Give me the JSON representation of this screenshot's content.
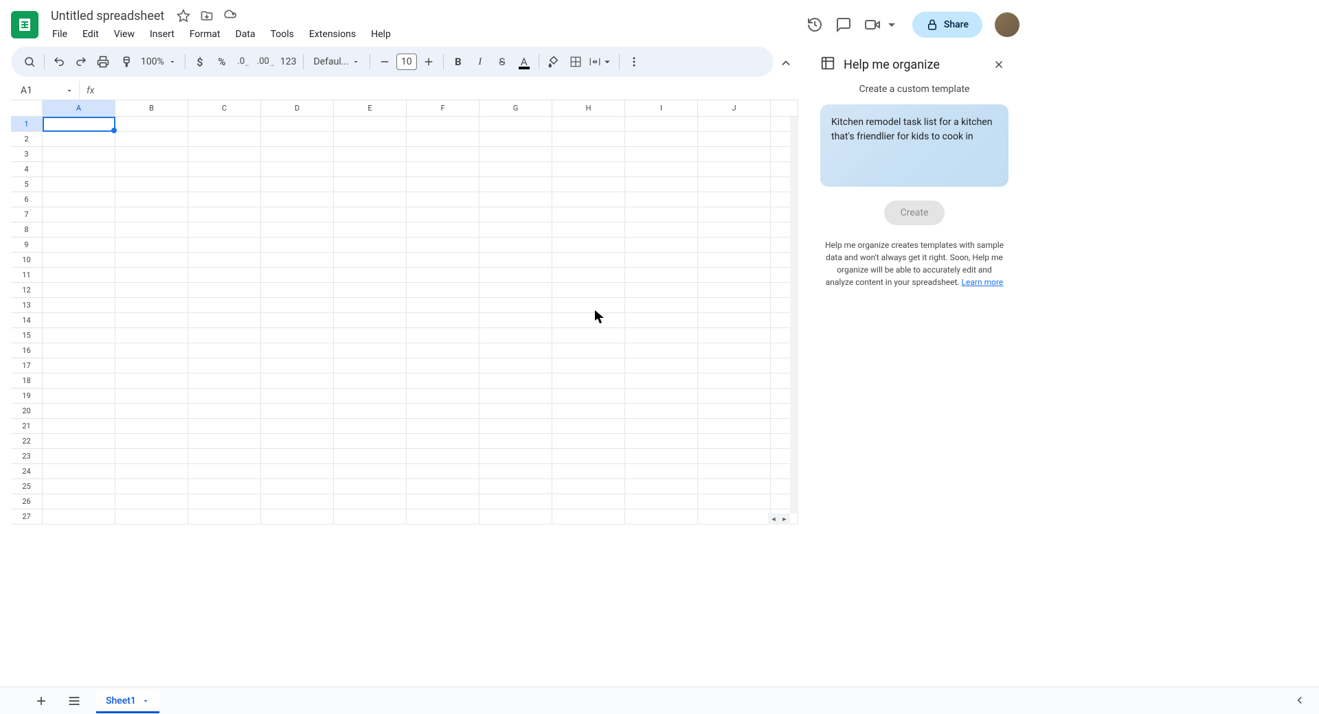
{
  "doc_title": "Untitled spreadsheet",
  "menu": [
    "File",
    "Edit",
    "View",
    "Insert",
    "Format",
    "Data",
    "Tools",
    "Extensions",
    "Help"
  ],
  "share_label": "Share",
  "toolbar": {
    "zoom": "100%",
    "font": "Defaul...",
    "font_size": "10",
    "num_fmt": "123"
  },
  "name_box": "A1",
  "columns": [
    "A",
    "B",
    "C",
    "D",
    "E",
    "F",
    "G",
    "H",
    "I",
    "J"
  ],
  "selected_col": "A",
  "row_count": 27,
  "selected_row": 1,
  "sheet_tab": "Sheet1",
  "side_panel": {
    "title": "Help me organize",
    "subtitle": "Create a custom template",
    "prompt": "Kitchen remodel task list for a kitchen that's friendlier for kids to cook in",
    "create_label": "Create",
    "help_text": "Help me organize creates templates with sample data and won't always get it right. Soon, Help me organize will be able to accurately edit and analyze content in your spreadsheet. ",
    "learn_more": "Learn more"
  }
}
